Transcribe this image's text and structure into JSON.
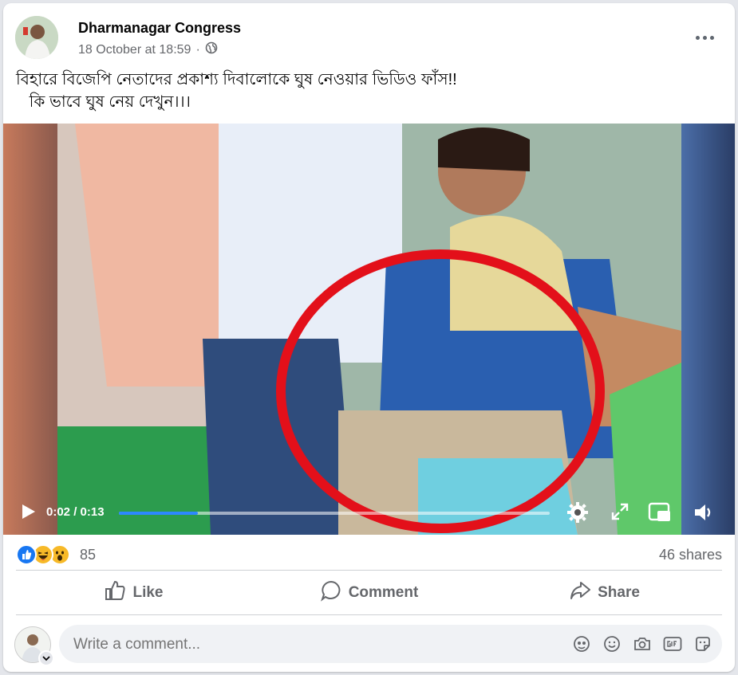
{
  "post": {
    "page_name": "Dharmanagar Congress",
    "timestamp": "18 October at 18:59",
    "separator": "·",
    "privacy_icon": "globe-icon",
    "more_icon": "ellipsis-icon",
    "text_line1": "বিহারে বিজেপি নেতাদের প্রকাশ্য দিবালোকে ঘুষ নেওয়ার ভিডিও ফাঁস!!",
    "text_line2": "   কি ভাবে ঘুষ নেয় দেখুন।।।"
  },
  "video": {
    "current_time": "0:02",
    "duration": "0:13",
    "time_display": "0:02 / 0:13",
    "progress": 0.183,
    "controls": [
      "play-icon",
      "settings-icon",
      "fullscreen-icon",
      "pip-icon",
      "volume-icon"
    ],
    "accent": "#2d88ff"
  },
  "stats": {
    "reactions": [
      "like",
      "haha",
      "wow"
    ],
    "reaction_count": "85",
    "shares": "46 shares"
  },
  "actions": {
    "like_label": "Like",
    "comment_label": "Comment",
    "share_label": "Share"
  },
  "comment": {
    "placeholder": "Write a comment...",
    "icons": [
      "avatar-sticker-icon",
      "emoji-icon",
      "camera-icon",
      "gif-icon",
      "sticker-icon"
    ]
  }
}
